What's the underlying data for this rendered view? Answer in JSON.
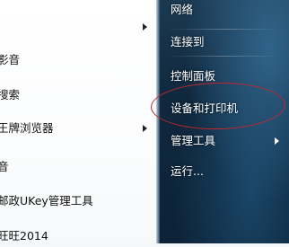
{
  "left_menu": {
    "items": [
      {
        "label": "影音",
        "has_submenu": false
      },
      {
        "label": "搜索",
        "has_submenu": false
      },
      {
        "label": "王牌浏览器",
        "has_submenu": true
      },
      {
        "label": "音",
        "has_submenu": false
      },
      {
        "label": "邮政UKey管理工具",
        "has_submenu": false
      },
      {
        "label": "旺旺2014",
        "has_submenu": false
      }
    ]
  },
  "right_menu": {
    "items": [
      {
        "label": "网络",
        "has_submenu": false
      },
      {
        "label": "连接到",
        "has_submenu": false
      },
      {
        "label": "控制面板",
        "has_submenu": false
      },
      {
        "label": "设备和打印机",
        "has_submenu": false
      },
      {
        "label": "管理工具",
        "has_submenu": true
      },
      {
        "label": "运行...",
        "has_submenu": false
      }
    ]
  },
  "annotation": {
    "highlighted_item": "设备和打印机",
    "color": "#c0282d"
  }
}
